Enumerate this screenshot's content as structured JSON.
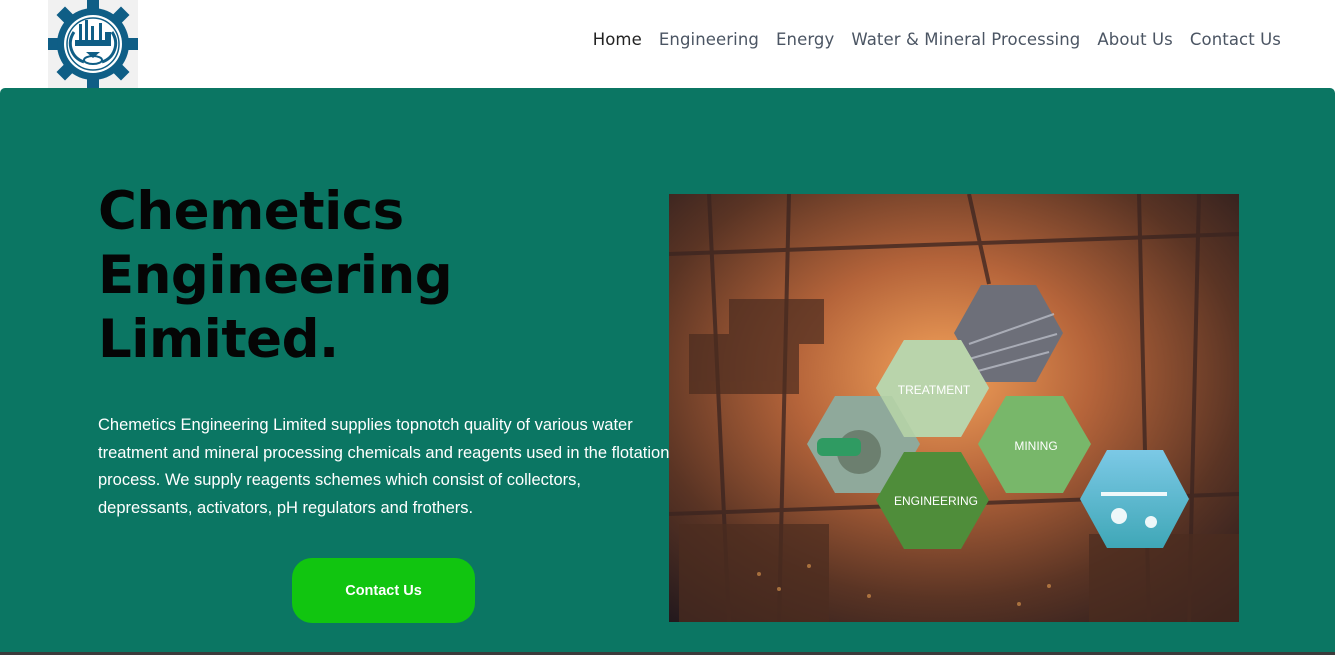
{
  "nav": {
    "items": [
      {
        "label": "Home",
        "active": true
      },
      {
        "label": "Engineering"
      },
      {
        "label": "Energy"
      },
      {
        "label": "Water & Mineral Processing"
      },
      {
        "label": "About Us"
      },
      {
        "label": "Contact Us"
      }
    ]
  },
  "hero": {
    "title_lines": [
      "Chemetics",
      "Engineering",
      "Limited."
    ],
    "description": "Chemetics Engineering Limited supplies topnotch quality of various water treatment and mineral processing chemicals and reagents used in the flotation process. We supply reagents schemes which consist of collectors, depressants, activators, pH regulators and frothers.",
    "cta_label": "Contact Us",
    "image_labels": {
      "treatment": "TREATMENT",
      "mining": "MINING",
      "engineering": "ENGINEERING"
    }
  },
  "colors": {
    "hero_bg": "#0b7663",
    "cta_bg": "#11c510",
    "logo_blue": "#0f5e86"
  },
  "icons": {
    "logo": "gear-factory-logo"
  }
}
